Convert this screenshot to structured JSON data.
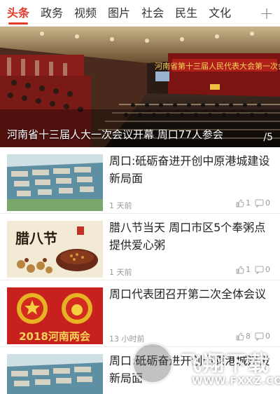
{
  "tabs": [
    {
      "label": "头条",
      "active": true
    },
    {
      "label": "政务",
      "active": false
    },
    {
      "label": "视频",
      "active": false
    },
    {
      "label": "图片",
      "active": false
    },
    {
      "label": "社会",
      "active": false
    },
    {
      "label": "民生",
      "active": false
    },
    {
      "label": "文化",
      "active": false
    }
  ],
  "add_button_label": "+",
  "colors": {
    "accent": "#e33a2c",
    "text": "#222222",
    "meta": "#999999"
  },
  "hero": {
    "caption": "河南省十三届人大一次会议开幕 周口77人参会",
    "counter": "/5",
    "banner_text": "河南省第十三届人民代表大会第一次会议"
  },
  "news": [
    {
      "title": "周口:砥砺奋进开创中原港城建设新局面",
      "time": "1 天前",
      "likes": "1",
      "comments": "0",
      "thumb": "port-aerial"
    },
    {
      "title": "腊八节当天 周口市区5个奉粥点提供爱心粥",
      "time": "1 天前",
      "likes": "1",
      "comments": "0",
      "thumb": "laba-porridge",
      "thumb_text": "腊八节"
    },
    {
      "title": "周口代表团召开第二次全体会议",
      "time": "13 小时前",
      "likes": "8",
      "comments": "0",
      "thumb": "henan-two-sessions",
      "thumb_text": "2018河南两会"
    },
    {
      "title": "周口:砥砺奋进开创中原港城建设新局面",
      "time": "",
      "likes": "",
      "comments": "",
      "thumb": "port-aerial"
    }
  ],
  "watermark": {
    "brand": "飞翔下载",
    "url": "WWW.FXXZ.COM"
  }
}
